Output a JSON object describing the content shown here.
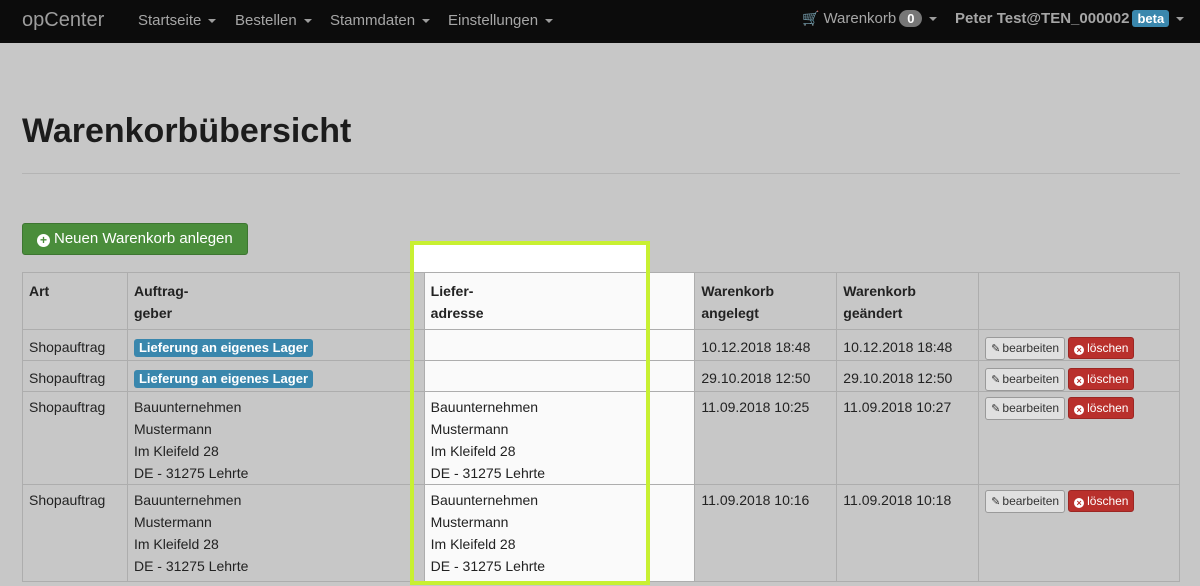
{
  "navbar": {
    "brand": "opCenter",
    "menu": [
      {
        "label": "Startseite"
      },
      {
        "label": "Bestellen"
      },
      {
        "label": "Stammdaten"
      },
      {
        "label": "Einstellungen"
      }
    ],
    "cart": {
      "label": "Warenkorb",
      "count": "0"
    },
    "user": {
      "name": "Peter Test@TEN_000002",
      "badge": "beta"
    }
  },
  "page": {
    "title": "Warenkorbübersicht",
    "new_button_label": "Neuen Warenkorb anlegen"
  },
  "table": {
    "headers": {
      "art": "Art",
      "auftraggeber_1": "Auftrag-",
      "auftraggeber_2": "geber",
      "lieferadresse_1": "Liefer-",
      "lieferadresse_2": "adresse",
      "angelegt_1": "Warenkorb",
      "angelegt_2": "angelegt",
      "geaendert_1": "Warenkorb",
      "geaendert_2": "geändert"
    },
    "actions": {
      "edit": "bearbeiten",
      "delete": "löschen"
    },
    "rows": [
      {
        "art": "Shopauftrag",
        "auftraggeber_badge": "Lieferung an eigenes Lager",
        "angelegt": "10.12.2018 18:48",
        "geaendert": "10.12.2018 18:48"
      },
      {
        "art": "Shopauftrag",
        "auftraggeber_badge": "Lieferung an eigenes Lager",
        "angelegt": "29.10.2018 12:50",
        "geaendert": "29.10.2018 12:50"
      },
      {
        "art": "Shopauftrag",
        "auftraggeber": [
          "Bauunternehmen",
          "Mustermann",
          "Im Kleifeld 28",
          "DE - 31275 Lehrte"
        ],
        "lieferadresse": [
          "Bauunternehmen",
          "Mustermann",
          "Im Kleifeld 28",
          "DE - 31275 Lehrte"
        ],
        "angelegt": "11.09.2018 10:25",
        "geaendert": "11.09.2018 10:27"
      },
      {
        "art": "Shopauftrag",
        "auftraggeber": [
          "Bauunternehmen",
          "Mustermann",
          "Im Kleifeld 28",
          "DE - 31275 Lehrte"
        ],
        "lieferadresse": [
          "Bauunternehmen",
          "Mustermann",
          "Im Kleifeld 28",
          "DE - 31275 Lehrte"
        ],
        "angelegt": "11.09.2018 10:16",
        "geaendert": "11.09.2018 10:18"
      }
    ]
  },
  "colors": {
    "highlight": "#c8f032",
    "badge_blue": "#3a87ad",
    "success_green": "#4a8d3b",
    "danger_red": "#b9302c"
  },
  "icons": [
    "cart-icon",
    "plus-circle-icon",
    "edit-icon",
    "x-circle-icon",
    "chevron-down-icon"
  ]
}
